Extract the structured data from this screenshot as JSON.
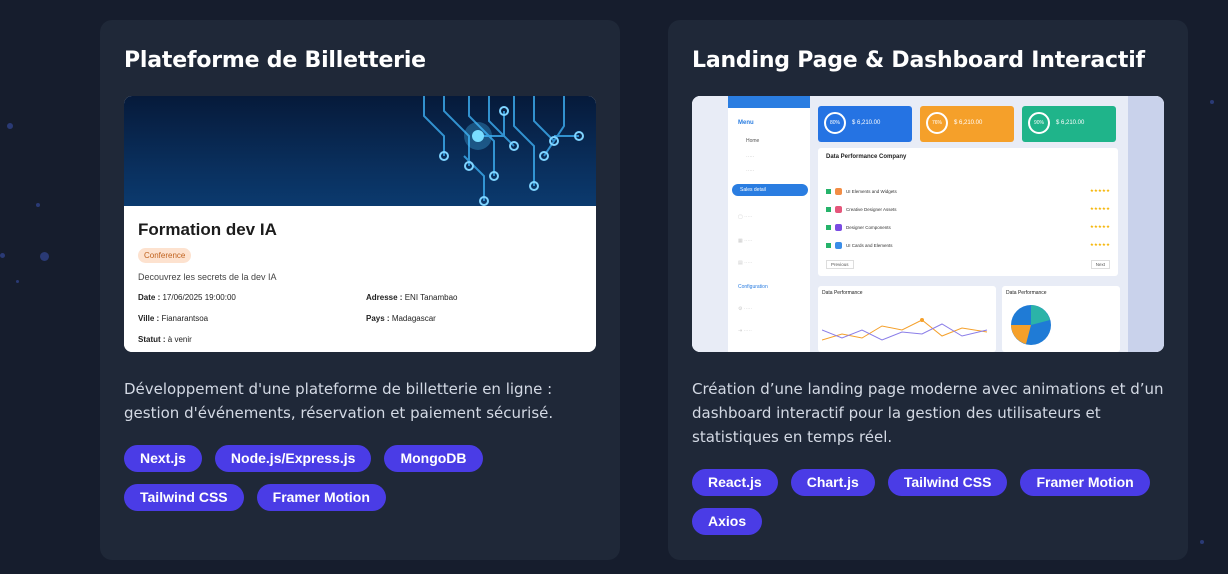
{
  "projects": [
    {
      "title": "Plateforme de Billetterie",
      "description": "Développement d'une plateforme de billetterie en ligne : gestion d'événements, réservation et paiement sécurisé.",
      "tags": [
        "Next.js",
        "Node.js/Express.js",
        "MongoDB",
        "Tailwind CSS",
        "Framer Motion"
      ],
      "preview": {
        "event_title": "Formation dev IA",
        "category": "Conference",
        "subtitle": "Decouvrez les secrets de la dev IA",
        "date_label": "Date :",
        "date_value": "17/06/2025 19:00:00",
        "address_label": "Adresse :",
        "address_value": "ENI Tanambao",
        "city_label": "Ville :",
        "city_value": "Fianarantsoa",
        "country_label": "Pays :",
        "country_value": "Madagascar",
        "status_label": "Statut :",
        "status_value": "à venir"
      }
    },
    {
      "title": "Landing Page & Dashboard Interactif",
      "description": "Création d’une landing page moderne avec animations et d’un dashboard interactif pour la gestion des utilisateurs et statistiques en temps réel.",
      "tags": [
        "React.js",
        "Chart.js",
        "Tailwind CSS",
        "Framer Motion",
        "Axios"
      ],
      "preview": {
        "menu_label": "Menu",
        "home_label": "Home",
        "sales_label": "Sales detail",
        "config_label": "Configuration",
        "kpi_values": [
          "$ 6,210.00",
          "$ 6,210.00",
          "$ 6,210.00"
        ],
        "kpi_percents": [
          "80%",
          "76%",
          "90%"
        ],
        "table_title": "Data Performance Company",
        "chart_title_1": "Data Performance",
        "chart_title_2": "Data Performance",
        "rows": [
          "UI Elements and Widgets",
          "Creative Designer Assets",
          "Designer Components",
          "UI Cards and Elements"
        ],
        "prev_label": "Previous",
        "next_label": "Next"
      }
    }
  ],
  "colors": {
    "background": "#161d2d",
    "card": "#1f2838",
    "tag": "#4a3ce6"
  }
}
